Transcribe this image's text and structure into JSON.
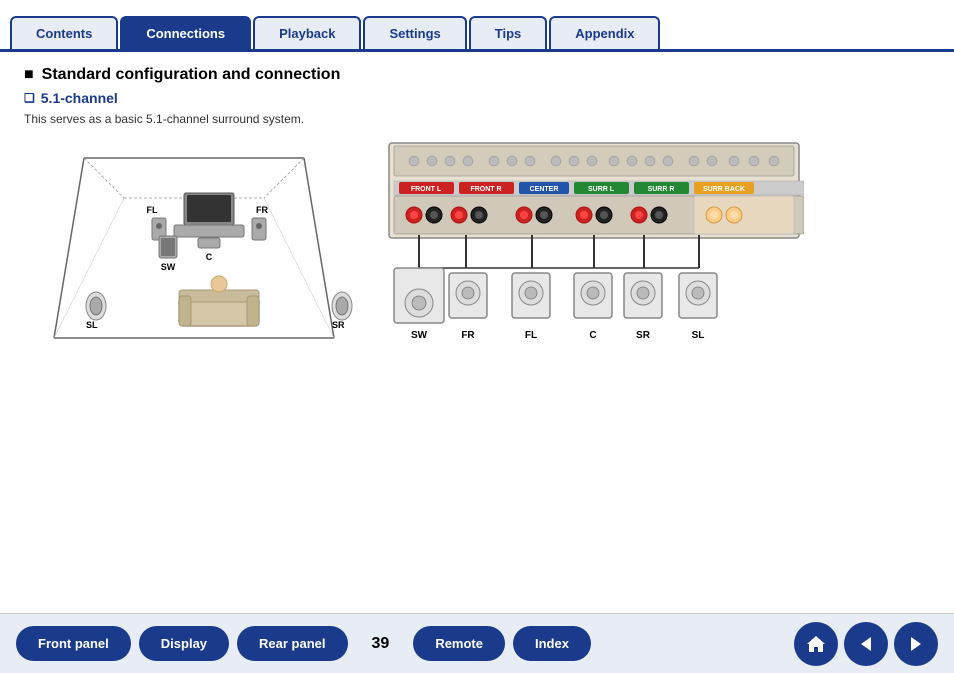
{
  "nav": {
    "tabs": [
      {
        "label": "Contents",
        "active": false
      },
      {
        "label": "Connections",
        "active": true
      },
      {
        "label": "Playback",
        "active": false
      },
      {
        "label": "Settings",
        "active": false
      },
      {
        "label": "Tips",
        "active": false
      },
      {
        "label": "Appendix",
        "active": false
      }
    ]
  },
  "content": {
    "section_title": "Standard configuration and connection",
    "subsection_title": "5.1-channel",
    "description": "This serves as a basic 5.1-channel surround system.",
    "room_labels": {
      "FL": "FL",
      "FR": "FR",
      "SL": "SL",
      "SR": "SR",
      "SW": "SW",
      "C": "C"
    },
    "connection_labels": {
      "SW": "SW",
      "FR": "FR",
      "FL": "FL",
      "C": "C",
      "SR": "SR",
      "SL": "SL"
    }
  },
  "bottom_nav": {
    "front_panel": "Front panel",
    "display": "Display",
    "rear_panel": "Rear panel",
    "page_number": "39",
    "remote": "Remote",
    "index": "Index"
  }
}
